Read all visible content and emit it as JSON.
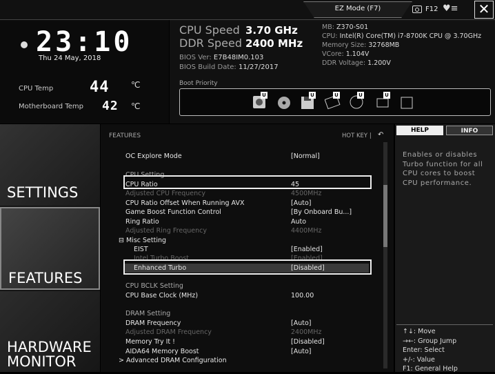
{
  "topbar": {
    "ez_mode": "EZ Mode (F7)",
    "f12": "F12",
    "close": "✕"
  },
  "clock": {
    "time": "23:10",
    "date": "Thu 24 May, 2018"
  },
  "temps": {
    "cpu_label": "CPU Temp",
    "cpu_value": "44",
    "cpu_unit": "℃",
    "mb_label": "Motherboard Temp",
    "mb_value": "42",
    "mb_unit": "℃"
  },
  "speeds": {
    "cpu_label": "CPU Speed",
    "cpu_value": "3.70 GHz",
    "ddr_label": "DDR Speed",
    "ddr_value": "2400 MHz"
  },
  "bios": {
    "ver_label": "BIOS Ver:",
    "ver": "E7B48IM0.103",
    "date_label": "BIOS Build Date:",
    "date": "11/27/2017"
  },
  "sysinfo": [
    {
      "label": "MB:",
      "value": "Z370-S01"
    },
    {
      "label": "CPU:",
      "value": "Intel(R) Core(TM) i7-8700K CPU @ 3.70GHz"
    },
    {
      "label": "Memory Size:",
      "value": "32768MB"
    },
    {
      "label": "VCore:",
      "value": "1.104V"
    },
    {
      "label": "DDR Voltage:",
      "value": "1.200V"
    }
  ],
  "boot": {
    "label": "Boot Priority",
    "badge": "U",
    "usb": "USB"
  },
  "sidebar": {
    "settings": "SETTINGS",
    "features": "FEATURES",
    "hw1": "HARDWARE",
    "hw2": "MONITOR"
  },
  "main": {
    "title": "FEATURES",
    "hotkey": "HOT KEY",
    "sep": "|"
  },
  "rows": {
    "oc_explore": {
      "label": "OC Explore Mode",
      "value": "[Normal]"
    },
    "cpu_setting": {
      "label": "CPU Setting"
    },
    "cpu_ratio": {
      "label": "CPU Ratio",
      "value": "45"
    },
    "adj_cpu": {
      "label": "Adjusted CPU Frequency",
      "value": "4500MHz"
    },
    "cpu_offset": {
      "label": "CPU Ratio Offset When Running AVX",
      "value": "[Auto]"
    },
    "boost": {
      "label": "Game Boost Function Control",
      "value": "[By Onboard Bu...]"
    },
    "ring": {
      "label": "Ring Ratio",
      "value": "Auto"
    },
    "adj_ring": {
      "label": "Adjusted Ring Frequency",
      "value": "4400MHz"
    },
    "misc": {
      "label": "Misc Setting",
      "toggle": "⊟"
    },
    "eist": {
      "label": "EIST",
      "value": "[Enabled]"
    },
    "intel_turbo": {
      "label": "Intel Turbo Boost",
      "value": "[Enabled]"
    },
    "enh_turbo": {
      "label": "Enhanced Turbo",
      "value": "[Disabled]"
    },
    "bclk": {
      "label": "CPU BCLK Setting"
    },
    "base_clock": {
      "label": "CPU Base Clock (MHz)",
      "value": "100.00"
    },
    "dram": {
      "label": "DRAM Setting"
    },
    "dram_freq": {
      "label": "DRAM Frequency",
      "value": "[Auto]"
    },
    "adj_dram": {
      "label": "Adjusted DRAM Frequency",
      "value": "2400MHz"
    },
    "mem_try": {
      "label": "Memory Try It !",
      "value": "[Disabled]"
    },
    "aida": {
      "label": "AIDA64 Memory Boost",
      "value": "[Auto]"
    },
    "adv_dram": {
      "label": "Advanced DRAM Configuration",
      "arrow": ">"
    }
  },
  "help": {
    "tab_help": "HELP",
    "tab_info": "INFO",
    "text": "Enables or disables Turbo function for all CPU cores to boost CPU performance.",
    "keys": [
      "↑↓: Move",
      "→←: Group Jump",
      "Enter: Select",
      "+/-: Value",
      "F1: General Help"
    ]
  }
}
